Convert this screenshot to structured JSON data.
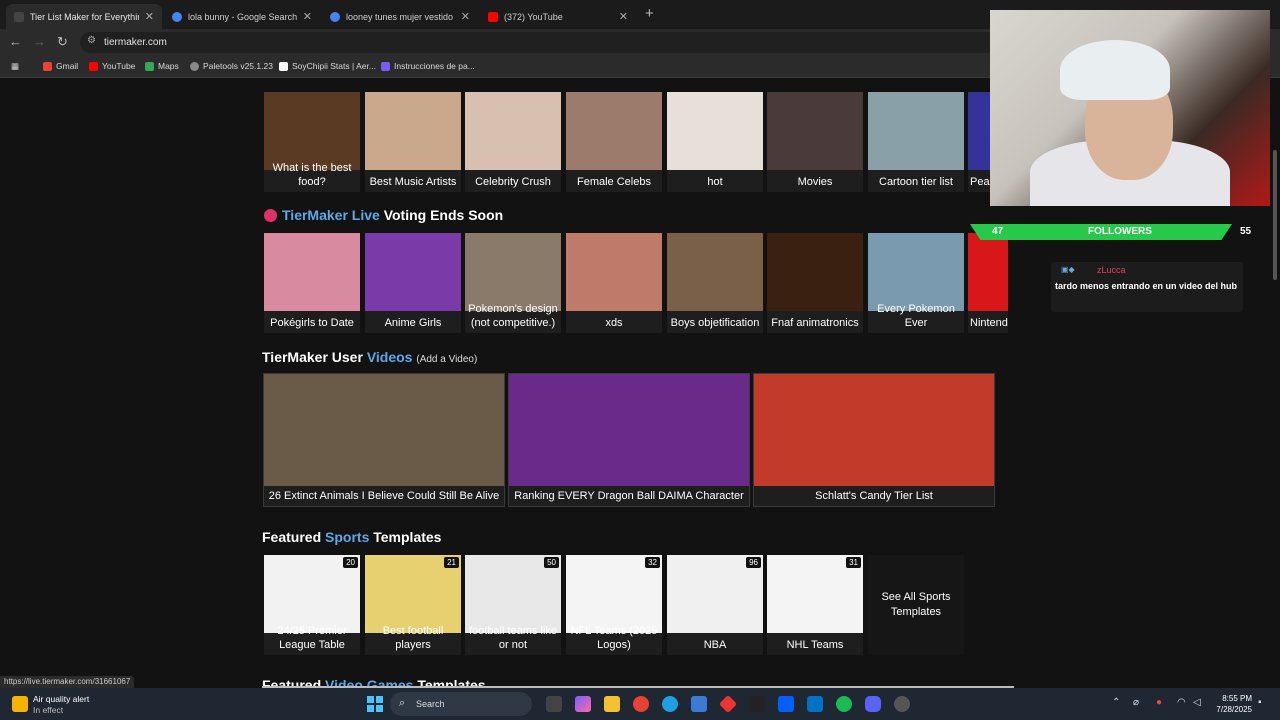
{
  "browser": {
    "tabs": [
      {
        "title": "Tier List Maker for Everything -",
        "color": "#222"
      },
      {
        "title": "lola bunny - Google Search",
        "color": "#4285f4"
      },
      {
        "title": "looney tunes mujer vestido ros",
        "color": "#4285f4"
      },
      {
        "title": "(372) YouTube",
        "color": "#ff0000"
      }
    ],
    "url": "tiermaker.com",
    "bookmarks": [
      "Gmail",
      "YouTube",
      "Maps",
      "Paletools v25.1.23",
      "SoyChipii Stats | Aer...",
      "Instrucciones de pa..."
    ],
    "status_url": "https://live.tiermaker.com/31661067"
  },
  "top_row": [
    {
      "label": "What is the best food?",
      "color": "#5a3a22"
    },
    {
      "label": "Best Music Artists",
      "color": "#c9a88c"
    },
    {
      "label": "Celebrity Crush",
      "color": "#d8c0b0"
    },
    {
      "label": "Female Celebs",
      "color": "#9c7b6c"
    },
    {
      "label": "hot",
      "color": "#e6e0d8"
    },
    {
      "label": "Movies",
      "color": "#4a3a3a"
    },
    {
      "label": "Cartoon tier list",
      "color": "#8aa0a8"
    },
    {
      "label": "Pea",
      "color": "#333399"
    }
  ],
  "live_section": {
    "prefix": "TierMaker Live",
    "suffix": "Voting Ends Soon"
  },
  "live_row": [
    {
      "label": "Pokégirls to Date",
      "color": "#d88aa0"
    },
    {
      "label": "Anime Girls",
      "color": "#7a3aa8"
    },
    {
      "label": "Pokemon's design (not competitive.)",
      "color": "#8a7a6a"
    },
    {
      "label": "xds",
      "color": "#c07a6a"
    },
    {
      "label": "Boys objetification",
      "color": "#7a6048"
    },
    {
      "label": "Fnaf animatronics",
      "color": "#3a2010"
    },
    {
      "label": "Every Pokemon Ever",
      "color": "#7a9ab0"
    },
    {
      "label": "Nintend",
      "color": "#d81818"
    }
  ],
  "videos_section": {
    "prefix": "TierMaker User",
    "highlight": "Videos",
    "link": "(Add a Video)"
  },
  "videos": [
    {
      "label": "26 Extinct Animals I Believe Could Still Be Alive",
      "color": "#6a5a48"
    },
    {
      "label": "Ranking EVERY Dragon Ball DAIMA Character",
      "color": "#6a2a8a"
    },
    {
      "label": "Schlatt's Candy Tier List",
      "color": "#c23a2a"
    }
  ],
  "sports_section": {
    "prefix": "Featured",
    "highlight": "Sports",
    "suffix": "Templates"
  },
  "sports": [
    {
      "label": "24/25 Premier League Table",
      "count": "20",
      "color": "#f2f2f2"
    },
    {
      "label": "Best football players",
      "count": "21",
      "color": "#e6d070"
    },
    {
      "label": "football teams like or not",
      "count": "50",
      "color": "#e8e8e8"
    },
    {
      "label": "NFL Teams (2025 Logos)",
      "count": "32",
      "color": "#f4f4f4"
    },
    {
      "label": "NBA",
      "count": "96",
      "color": "#f0f0f0"
    },
    {
      "label": "NHL Teams",
      "count": "31",
      "color": "#f4f4f4"
    }
  ],
  "see_all": "See All Sports Templates",
  "bottom_section": {
    "prefix": "Featured",
    "highlight": "Video Games",
    "suffix": "Templates"
  },
  "stream": {
    "followers_left": "47",
    "followers_label": "FOLLOWERS",
    "followers_right": "55"
  },
  "chat": {
    "user": "zLucca",
    "message": "tardo menos entrando en un video del hub"
  },
  "taskbar": {
    "alert_title": "Air quality alert",
    "alert_sub": "In effect",
    "search": "Search",
    "time": "8:55 PM",
    "date": "7/28/2025"
  }
}
